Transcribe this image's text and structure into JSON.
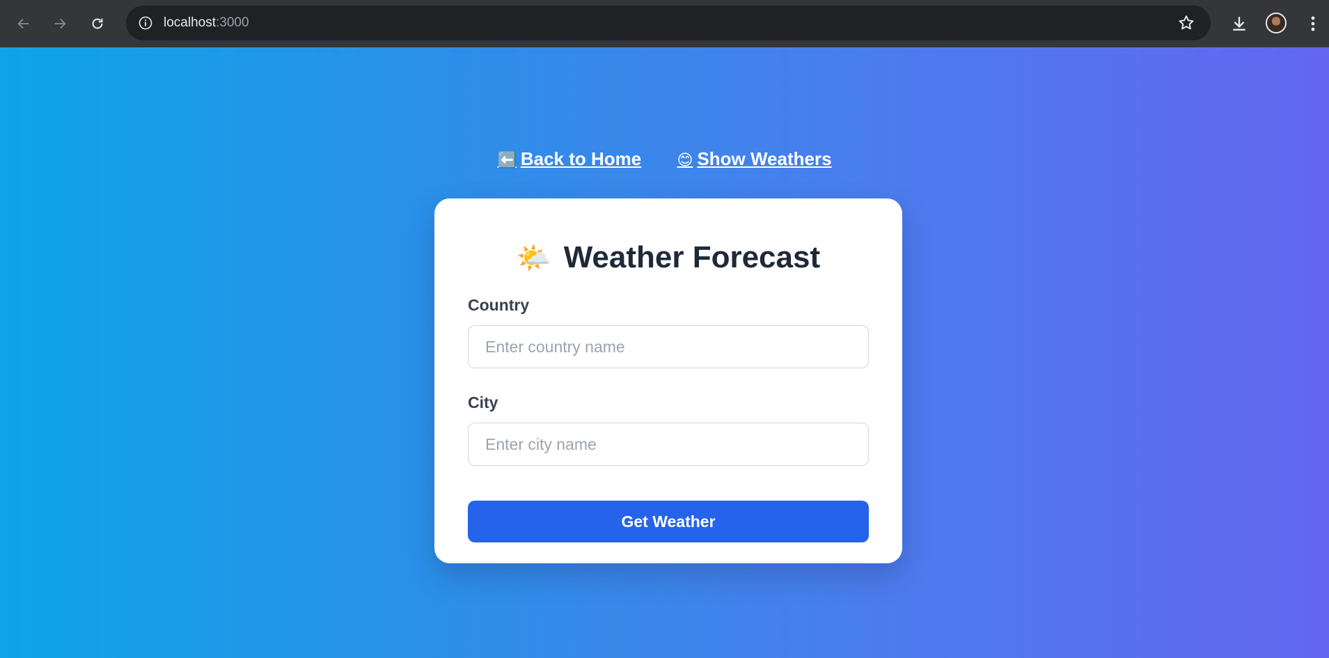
{
  "browser": {
    "url_host": "localhost",
    "url_port": ":3000",
    "icons": {
      "back": "arrow-left-icon",
      "forward": "arrow-right-icon",
      "reload": "reload-icon",
      "site_info": "info-icon",
      "bookmark": "star-icon",
      "downloads": "download-icon",
      "profile": "avatar",
      "menu": "kebab-menu-icon"
    }
  },
  "nav": {
    "home_emoji": "⬅️",
    "home_label": "Back to Home",
    "weathers_emoji": "😊",
    "weathers_label": "Show Weathers"
  },
  "form": {
    "title_emoji": "🌤️",
    "title": "Weather Forecast",
    "country_label": "Country",
    "country_placeholder": "Enter country name",
    "city_label": "City",
    "city_placeholder": "Enter city name",
    "submit_label": "Get Weather"
  },
  "colors": {
    "gradient_start": "#0ea5e9",
    "gradient_end": "#6366f1",
    "button": "#2563eb",
    "title_text": "#1f2937"
  }
}
